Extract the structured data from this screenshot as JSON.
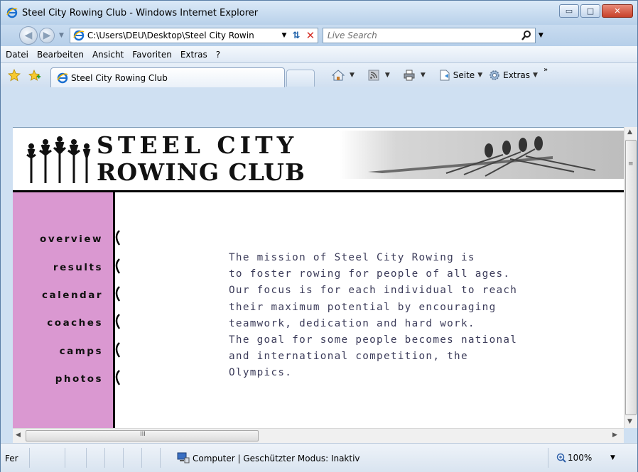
{
  "window": {
    "title": "Steel City Rowing Club - Windows Internet Explorer",
    "controls": {
      "minimize": "▭",
      "maximize": "□",
      "close": "✕"
    }
  },
  "address_bar": {
    "url": "C:\\Users\\DEU\\Desktop\\Steel City Rowin",
    "search_placeholder": "Live Search"
  },
  "menu": [
    "Datei",
    "Bearbeiten",
    "Ansicht",
    "Favoriten",
    "Extras",
    "?"
  ],
  "tab": {
    "label": "Steel City Rowing Club"
  },
  "command_bar": {
    "page_label": "Seite",
    "tools_label": "Extras",
    "more": "»"
  },
  "site": {
    "title_line1": "STEEL CITY",
    "title_line2": "ROWING CLUB",
    "nav": [
      "overview",
      "results",
      "calendar",
      "coaches",
      "camps",
      "photos"
    ],
    "mission": [
      "The mission of Steel City Rowing is",
      "to foster rowing for people of all ages.",
      "Our focus is for each individual to reach",
      "their maximum potential by encouraging",
      "teamwork, dedication and hard work.",
      "The goal for some people becomes national",
      "and international competition, the",
      "Olympics."
    ],
    "colors": {
      "sidebar": "#da98d1",
      "text": "#3c3c5a"
    }
  },
  "scrollbar": {
    "grip": "III"
  },
  "status": {
    "text": "Fer",
    "zone": "Computer | Geschützter Modus: Inaktiv",
    "zoom": "100%"
  },
  "icons": [
    "ie-logo-icon",
    "back-icon",
    "forward-icon",
    "refresh-icon",
    "stop-icon",
    "search-icon",
    "favorites-star-icon",
    "add-favorites-icon",
    "home-icon",
    "feeds-icon",
    "print-icon",
    "page-icon",
    "tools-gear-icon",
    "computer-zone-icon",
    "zoom-icon"
  ]
}
